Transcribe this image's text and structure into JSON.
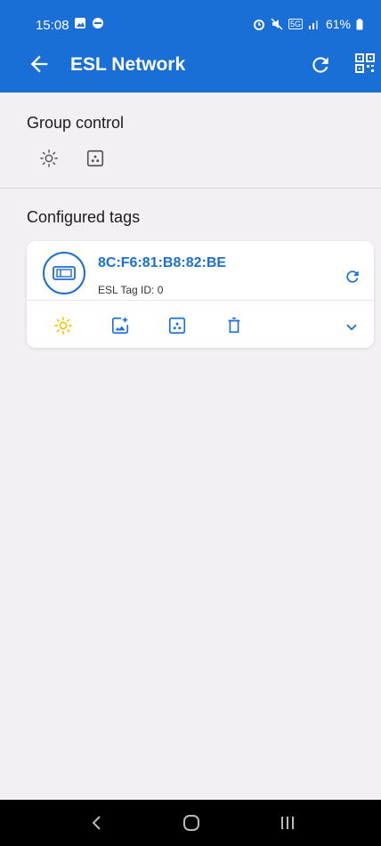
{
  "status_bar": {
    "time": "15:08",
    "battery": "61%",
    "network": "5G"
  },
  "app_bar": {
    "title": "ESL Network",
    "icons": [
      "back-arrow-icon",
      "refresh-icon",
      "qr-scan-icon"
    ]
  },
  "group_control": {
    "title": "Group control",
    "actions": [
      "light-icon",
      "image-icon"
    ]
  },
  "configured_tags": {
    "title": "Configured tags",
    "tags": [
      {
        "mac": "8C:F6:81:B8:82:BE",
        "tag_id": "ESL Tag ID: 0",
        "actions": [
          "light-icon",
          "add-image-icon",
          "image-icon",
          "delete-icon",
          "expand-icon"
        ]
      }
    ]
  },
  "colors": {
    "primary": "#1a6fd6",
    "light_active": "#f5c400",
    "background": "#f2f0f3"
  }
}
